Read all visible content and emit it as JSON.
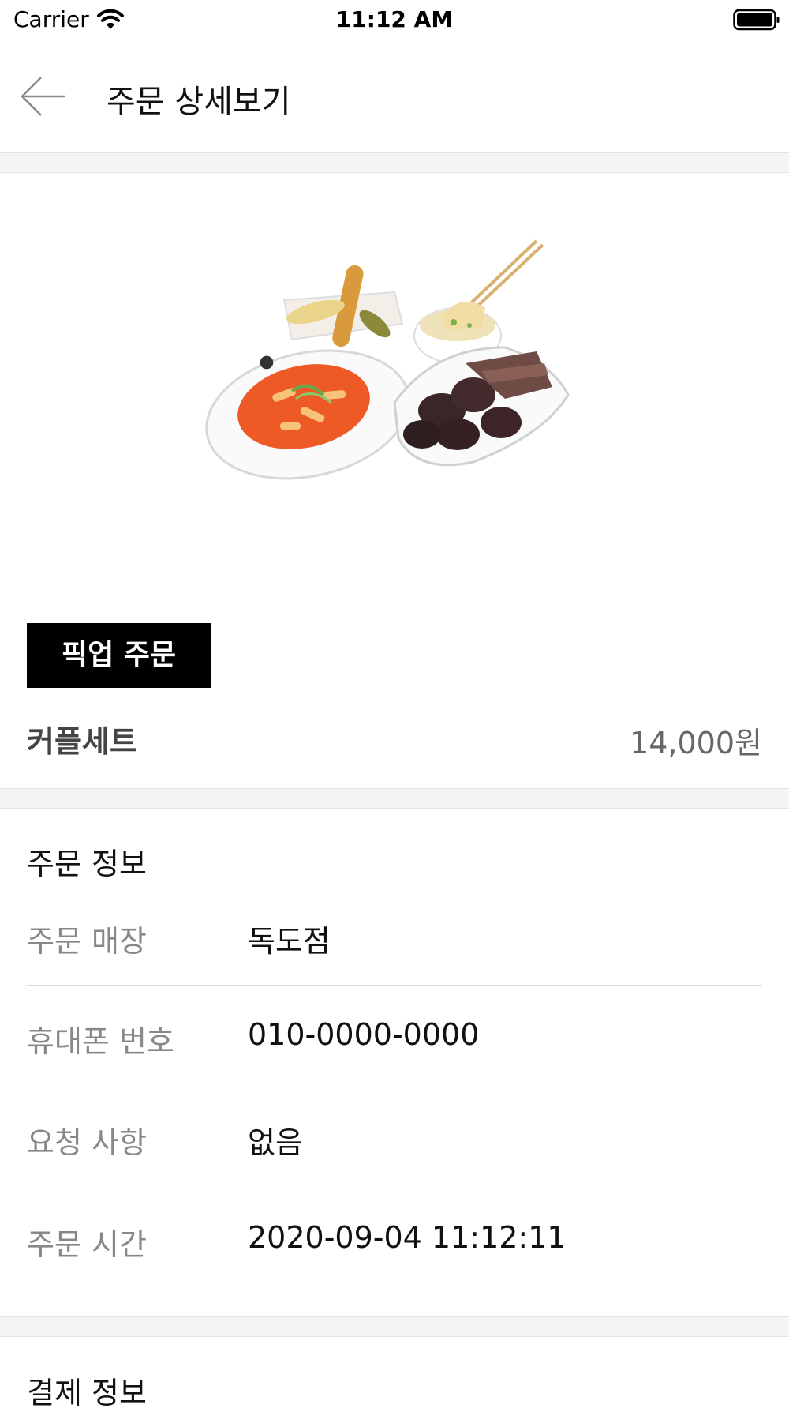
{
  "status_bar": {
    "carrier": "Carrier",
    "time": "11:12 AM"
  },
  "header": {
    "title": "주문 상세보기",
    "back_icon": "arrow-left-icon"
  },
  "product": {
    "order_type": "픽업 주문",
    "name": "커플세트",
    "price": "14,000원"
  },
  "order_info": {
    "title": "주문 정보",
    "rows": [
      {
        "label": "주문 매장",
        "value": "독도점"
      },
      {
        "label": "휴대폰 번호",
        "value": "010-0000-0000"
      },
      {
        "label": "요청 사항",
        "value": "없음"
      },
      {
        "label": "주문 시간",
        "value": "2020-09-04 11:12:11"
      }
    ]
  },
  "payment_info": {
    "title": "결제 정보"
  },
  "colors": {
    "badge_bg": "#000000",
    "section_gap": "#f4f4f4",
    "label_gray": "#888888"
  }
}
